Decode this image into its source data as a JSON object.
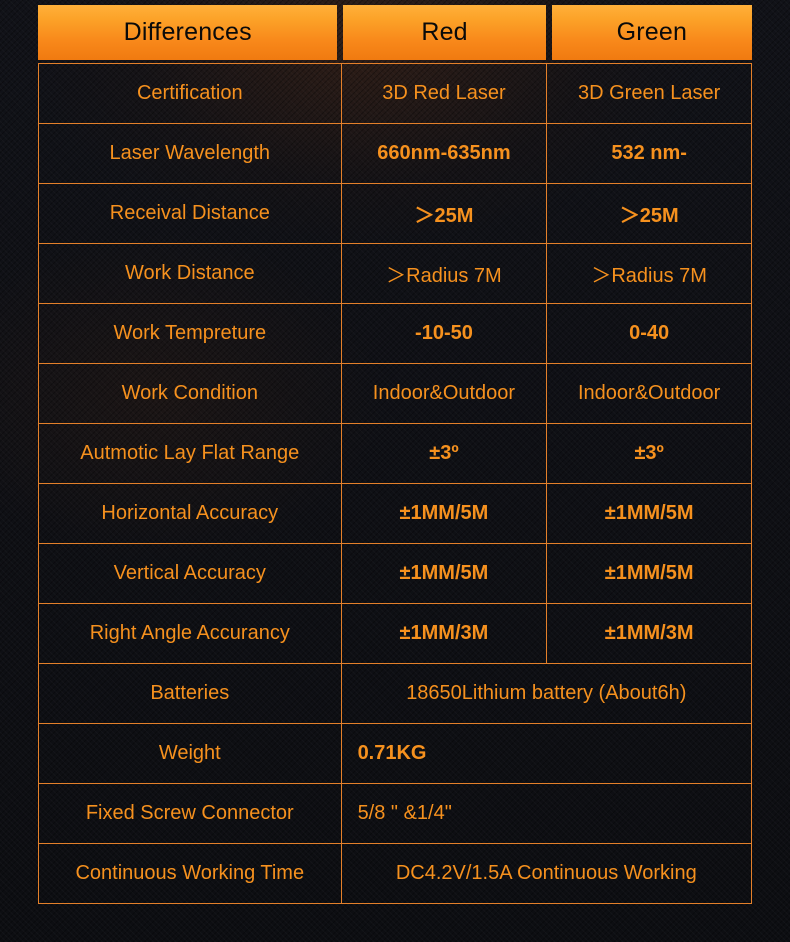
{
  "table": {
    "header": {
      "label_col": "Differences",
      "red_col": "Red",
      "green_col": "Green"
    },
    "colors": {
      "header_gradient_top": "#ffb03a",
      "header_gradient_bottom": "#f07a10",
      "header_text": "#0a0a0a",
      "grid_line": "#e4802a",
      "cell_text": "#f6911e",
      "background": "#13141a"
    },
    "rows": [
      {
        "label": "Certification",
        "red": "3D Red Laser",
        "green": "3D Green Laser",
        "bold": false,
        "merged": false
      },
      {
        "label": "Laser Wavelength",
        "red": "660nm-635nm",
        "green": "532 nm-",
        "bold": true,
        "merged": false
      },
      {
        "label": "Receival Distance",
        "red": "＞25M",
        "green": "＞25M",
        "bold": true,
        "merged": false
      },
      {
        "label": "Work Distance",
        "red": "＞Radius 7M",
        "green": "＞Radius 7M",
        "bold": false,
        "merged": false
      },
      {
        "label": "Work Tempreture",
        "red": "-10-50",
        "green": "0-40",
        "bold": true,
        "merged": false
      },
      {
        "label": "Work Condition",
        "red": "Indoor&Outdoor",
        "green": "Indoor&Outdoor",
        "bold": false,
        "merged": false
      },
      {
        "label": "Autmotic Lay Flat Range",
        "red": "±3º",
        "green": "±3º",
        "bold": true,
        "merged": false
      },
      {
        "label": "Horizontal Accuracy",
        "red": "±1MM/5M",
        "green": "±1MM/5M",
        "bold": true,
        "merged": false
      },
      {
        "label": "Vertical Accuracy",
        "red": "±1MM/5M",
        "green": "±1MM/5M",
        "bold": true,
        "merged": false
      },
      {
        "label": "Right Angle Accurancy",
        "red": "±1MM/3M",
        "green": "±1MM/3M",
        "bold": true,
        "merged": false
      },
      {
        "label": "Batteries",
        "value": "18650Lithium battery (About6h)",
        "bold": false,
        "merged": true,
        "align": "center"
      },
      {
        "label": "Weight",
        "value": "0.71KG",
        "bold": true,
        "merged": true,
        "align": "left"
      },
      {
        "label": "Fixed Screw Connector",
        "value": "5/8 \" &1/4\"",
        "bold": false,
        "merged": true,
        "align": "left"
      },
      {
        "label": "Continuous Working Time",
        "value": "DC4.2V/1.5A Continuous Working",
        "bold": false,
        "merged": true,
        "align": "center"
      }
    ]
  }
}
